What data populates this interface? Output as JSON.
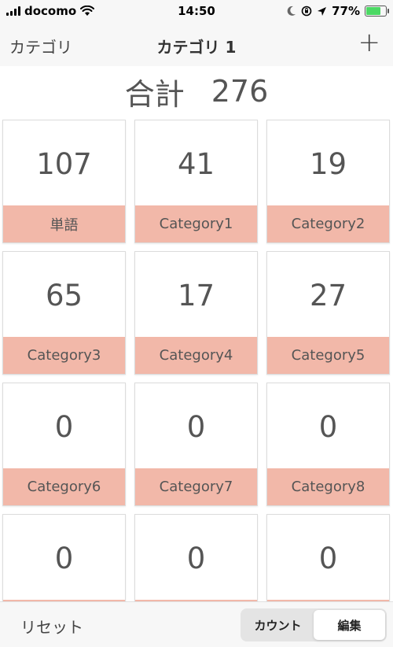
{
  "status_bar": {
    "carrier": "docomo",
    "time": "14:50",
    "battery": "77%",
    "battery_level": 0.77
  },
  "nav": {
    "back_label": "カテゴリ",
    "title": "カテゴリ 1",
    "add_label": "+"
  },
  "total": {
    "label": "合計",
    "value": "276"
  },
  "categories": [
    {
      "count": "107",
      "name": "単語"
    },
    {
      "count": "41",
      "name": "Category1"
    },
    {
      "count": "19",
      "name": "Category2"
    },
    {
      "count": "65",
      "name": "Category3"
    },
    {
      "count": "17",
      "name": "Category4"
    },
    {
      "count": "27",
      "name": "Category5"
    },
    {
      "count": "0",
      "name": "Category6"
    },
    {
      "count": "0",
      "name": "Category7"
    },
    {
      "count": "0",
      "name": "Category8"
    },
    {
      "count": "0",
      "name": ""
    },
    {
      "count": "0",
      "name": ""
    },
    {
      "count": "0",
      "name": ""
    }
  ],
  "toolbar": {
    "reset_label": "リセット",
    "segments": [
      "カウント",
      "編集"
    ],
    "selected_segment": "編集"
  },
  "colors": {
    "label_bg": "#f2b8a9",
    "battery_fill": "#4cd964"
  },
  "icons": [
    "wifi-icon",
    "moon-icon",
    "rotation-lock-icon",
    "location-arrow-icon",
    "battery-charging-icon",
    "plus-icon"
  ]
}
